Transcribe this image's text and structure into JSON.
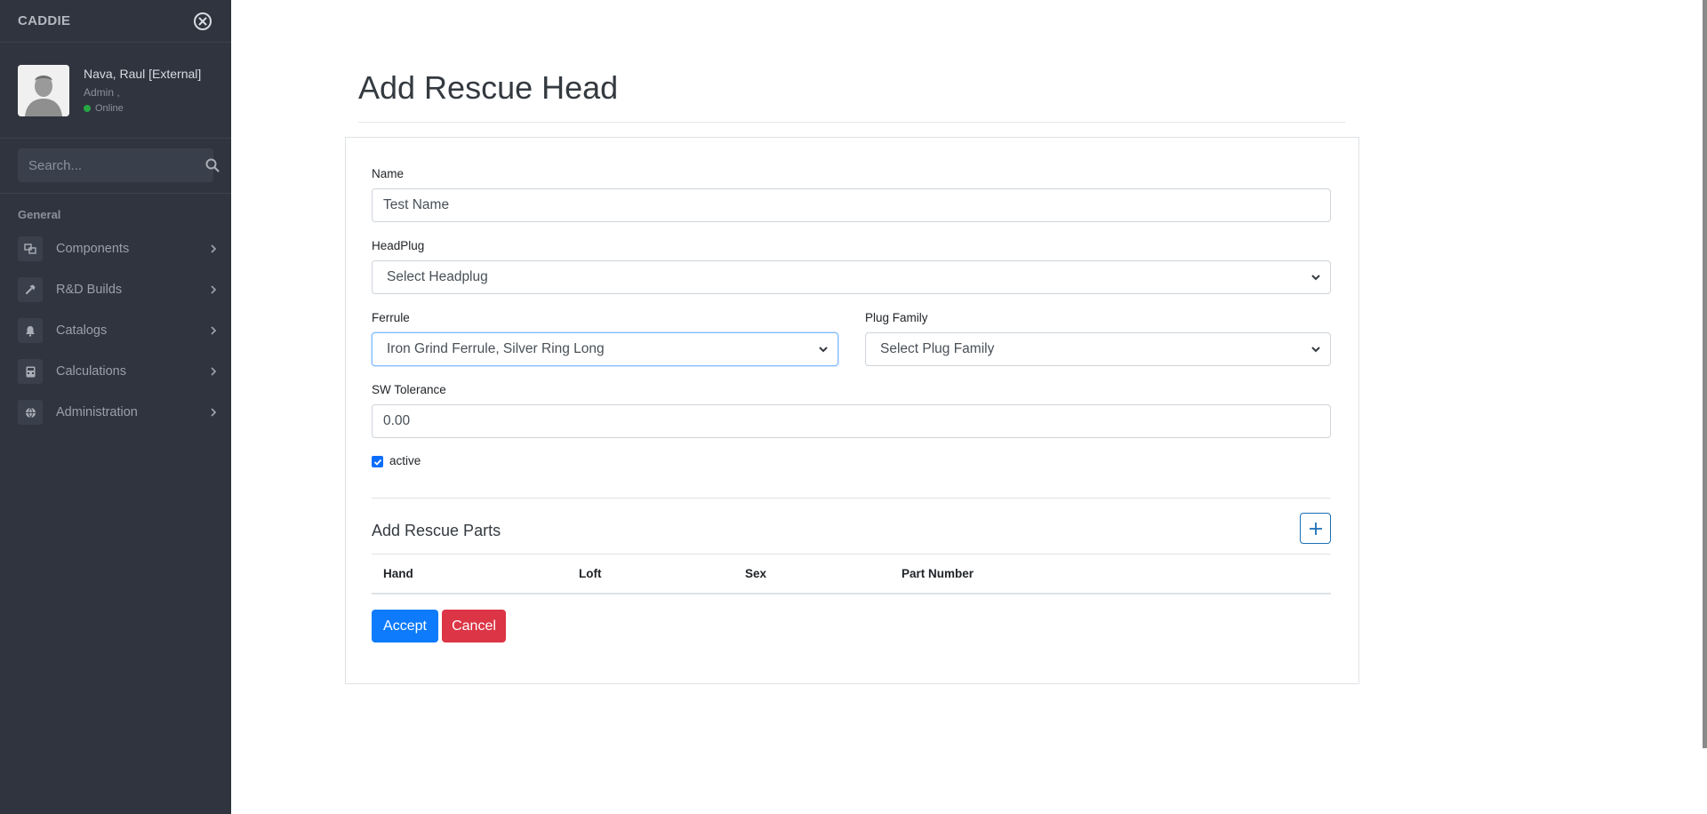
{
  "sidebar": {
    "brand": "CADDIE",
    "user": {
      "name": "Nava, Raul [External]",
      "role": "Admin ,",
      "status": "Online"
    },
    "search": {
      "placeholder": "Search..."
    },
    "section_header": "General",
    "items": [
      {
        "label": "Components",
        "icon": "components-icon"
      },
      {
        "label": "R&D Builds",
        "icon": "hammer-icon"
      },
      {
        "label": "Catalogs",
        "icon": "bell-icon"
      },
      {
        "label": "Calculations",
        "icon": "calculator-icon"
      },
      {
        "label": "Administration",
        "icon": "globe-icon"
      }
    ]
  },
  "page": {
    "title": "Add Rescue Head"
  },
  "form": {
    "name": {
      "label": "Name",
      "value": "Test Name"
    },
    "headplug": {
      "label": "HeadPlug",
      "selected": "Select Headplug"
    },
    "ferrule": {
      "label": "Ferrule",
      "selected": "Iron Grind Ferrule, Silver Ring Long"
    },
    "plug_family": {
      "label": "Plug Family",
      "selected": "Select Plug Family"
    },
    "sw_tolerance": {
      "label": "SW Tolerance",
      "value": "0.00"
    },
    "active": {
      "label": "active",
      "checked": true
    }
  },
  "parts": {
    "title": "Add Rescue Parts",
    "columns": [
      "Hand",
      "Loft",
      "Sex",
      "Part Number"
    ]
  },
  "actions": {
    "accept": "Accept",
    "cancel": "Cancel"
  },
  "colors": {
    "sidebar_bg": "#2f343e",
    "accept": "#0d7bfb",
    "cancel": "#dc3545",
    "online": "#28a745"
  }
}
